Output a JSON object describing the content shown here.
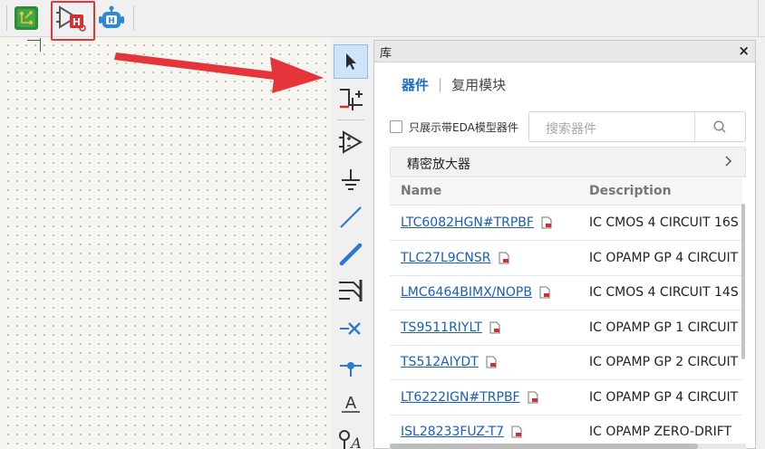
{
  "toolbar": {
    "buttons": [
      {
        "name": "pcb-board-icon"
      },
      {
        "name": "schematic-simulation-icon"
      },
      {
        "name": "robot-assistant-icon"
      }
    ]
  },
  "tools": [
    "select-icon",
    "bus-wire-icon",
    "opamp-symbol-icon",
    "ground-icon",
    "wire-icon",
    "bus-icon",
    "bus-entry-icon",
    "no-connect-icon",
    "junction-icon",
    "text-icon",
    "net-label-icon"
  ],
  "panel": {
    "title": "库",
    "close": "×",
    "tabs": [
      {
        "label": "器件",
        "active": true
      },
      {
        "label": "复用模块",
        "active": false
      }
    ],
    "tab_separator": "|",
    "eda_filter_label": "只展示带EDA模型器件",
    "search_placeholder": "搜索器件",
    "category": "精密放大器",
    "columns": {
      "name": "Name",
      "description": "Description"
    },
    "rows": [
      {
        "name": "LTC6082HGN#TRPBF",
        "description": "IC CMOS 4 CIRCUIT 16S"
      },
      {
        "name": "TLC27L9CNSR",
        "description": "IC OPAMP GP 4 CIRCUIT"
      },
      {
        "name": "LMC6464BIMX/NOPB",
        "description": "IC CMOS 4 CIRCUIT 14S"
      },
      {
        "name": "TS9511RIYLT",
        "description": "IC OPAMP GP 1 CIRCUIT"
      },
      {
        "name": "TS512AIYDT",
        "description": "IC OPAMP GP 2 CIRCUIT"
      },
      {
        "name": "LT6222IGN#TRPBF",
        "description": "IC OPAMP GP 4 CIRCUIT"
      },
      {
        "name": "ISL28233FUZ-T7",
        "description": "IC OPAMP ZERO-DRIFT"
      }
    ]
  },
  "colors": {
    "accent": "#1e6fc2",
    "annotation": "#e5343a",
    "link": "#1a5fb4"
  }
}
